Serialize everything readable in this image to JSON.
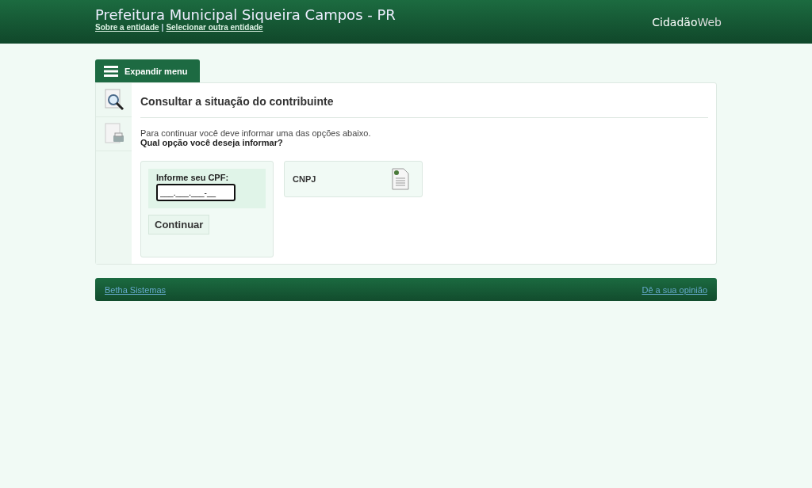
{
  "header": {
    "title": "Prefeitura Municipal Siqueira Campos - PR",
    "links": [
      "Sobre a entidade",
      "Selecionar outra entidade"
    ],
    "separator": "|",
    "logo": "**Cidadão**Web"
  },
  "menu_button": {
    "label": "Expandir menu"
  },
  "page": {
    "title": "Consultar a situação do contribuinte",
    "intro": "Para continuar você deve informar uma das opções abaixo.",
    "question": "Qual opção você deseja informar?"
  },
  "options": [
    {
      "kind": "form",
      "label": "Informe seu CPF:",
      "value": "___.___.___-__",
      "button": "Continuar"
    },
    {
      "kind": "choice",
      "label": "CNPJ"
    }
  ],
  "footer": {
    "left_link": "Betha Sistemas",
    "right_link": "Dê a sua opinião"
  }
}
